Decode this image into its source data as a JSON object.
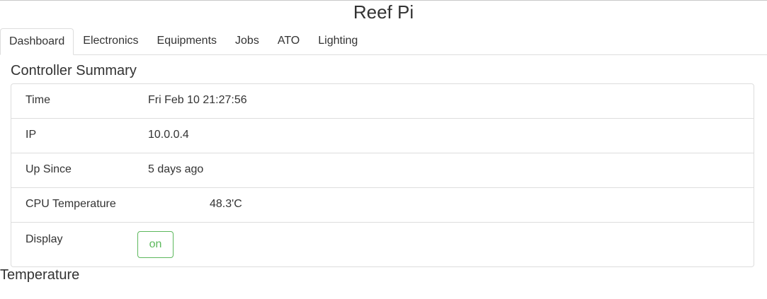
{
  "app": {
    "title": "Reef Pi"
  },
  "tabs": [
    {
      "label": "Dashboard",
      "active": true
    },
    {
      "label": "Electronics",
      "active": false
    },
    {
      "label": "Equipments",
      "active": false
    },
    {
      "label": "Jobs",
      "active": false
    },
    {
      "label": "ATO",
      "active": false
    },
    {
      "label": "Lighting",
      "active": false
    }
  ],
  "summary": {
    "title": "Controller Summary",
    "rows": [
      {
        "label": "Time",
        "value": "Fri Feb 10 21:27:56"
      },
      {
        "label": "IP",
        "value": "10.0.0.4"
      },
      {
        "label": "Up Since",
        "value": "5 days ago"
      },
      {
        "label": "CPU Temperature",
        "value": "48.3'C"
      }
    ],
    "display": {
      "label": "Display",
      "button_label": "on"
    }
  },
  "temperature": {
    "title": "Temperature"
  },
  "colors": {
    "success": "#5cb85c",
    "border": "#dddddd"
  }
}
